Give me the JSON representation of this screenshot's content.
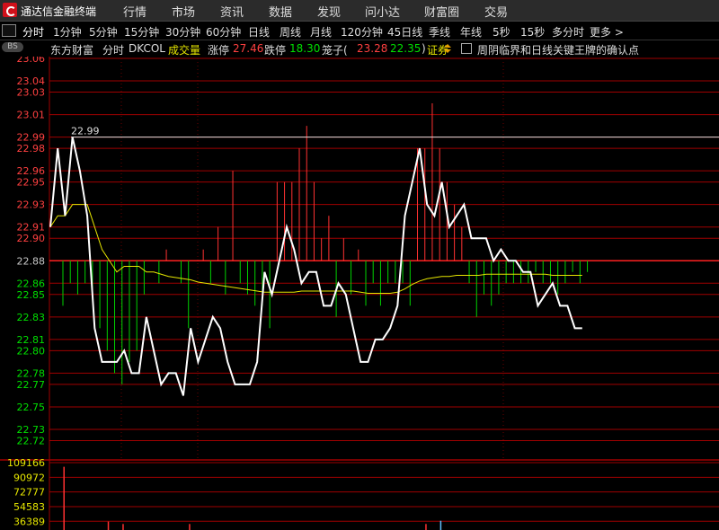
{
  "app": {
    "title": "通达信金融终端"
  },
  "menu": [
    "行情",
    "市场",
    "资讯",
    "数据",
    "发现",
    "问小达",
    "财富圈",
    "交易"
  ],
  "periods": {
    "active": "分时",
    "items": [
      "分时",
      "1分钟",
      "5分钟",
      "15分钟",
      "30分钟",
      "60分钟",
      "日线",
      "周线",
      "月线",
      "120分钟",
      "45日线",
      "季线",
      "年线",
      "5秒",
      "15秒",
      "多分时",
      "更多 >"
    ]
  },
  "info": {
    "bs_badge": "BS",
    "stock_name": "东方财富",
    "mode": "分时",
    "indicator": "DKCOL",
    "volume_label": "成交量",
    "limit_up_label": "涨停",
    "limit_up_value": "27.46",
    "limit_down_label": "跌停",
    "limit_down_value": "18.30",
    "cage_label": "笼子(",
    "cage_high": "23.28",
    "cage_low": "22.35",
    "cage_close": ")",
    "sector": "证券",
    "news": "周阴临界和日线关键王牌的确认点"
  },
  "colors": {
    "up": "#ff3232",
    "down": "#00d200",
    "grid": "#a00000",
    "price_line": "#ffffff",
    "avg_line": "#e6e600",
    "axis_up": "#ff4040",
    "axis_down": "#00e000",
    "axis_base": "#c8c8c8",
    "volume_axis": "#e6e600"
  },
  "chart_data": [
    {
      "type": "line",
      "title": "",
      "y_ticks": [
        "23.06",
        "23.04",
        "23.03",
        "23.01",
        "22.99",
        "22.98",
        "22.96",
        "22.95",
        "22.93",
        "22.91",
        "22.90",
        "22.88",
        "22.86",
        "22.85",
        "22.83",
        "22.81",
        "22.80",
        "22.78",
        "22.77",
        "22.75",
        "22.73",
        "22.72"
      ],
      "ylim": [
        22.71,
        23.06
      ],
      "base_price": 22.88,
      "reference_line": {
        "value": 22.99,
        "label": "22.99"
      },
      "series": [
        {
          "values": [
            22.91,
            22.98,
            22.92,
            22.99,
            22.96,
            22.92,
            22.82,
            22.79,
            22.79,
            22.79,
            22.8,
            22.78,
            22.78,
            22.83,
            22.8,
            22.77,
            22.78,
            22.78,
            22.76,
            22.82,
            22.79,
            22.81,
            22.83,
            22.82,
            22.79,
            22.77,
            22.77,
            22.77,
            22.79,
            22.87,
            22.85,
            22.88,
            22.91,
            22.89,
            22.86,
            22.87,
            22.87,
            22.84,
            22.84,
            22.86,
            22.85,
            22.82,
            22.79,
            22.79,
            22.81,
            22.81,
            22.82,
            22.84,
            22.92,
            22.95,
            22.98,
            22.93,
            22.92,
            22.95,
            22.91,
            22.92,
            22.93,
            22.9,
            22.9,
            22.9,
            22.88,
            22.89,
            22.88,
            22.88,
            22.87,
            22.87,
            22.84,
            22.85,
            22.86,
            22.84,
            22.84,
            22.82,
            22.82
          ]
        },
        {
          "values": [
            22.91,
            22.92,
            22.92,
            22.93,
            22.93,
            22.93,
            22.91,
            22.89,
            22.88,
            22.87,
            22.875,
            22.875,
            22.875,
            22.87,
            22.87,
            22.868,
            22.866,
            22.865,
            22.864,
            22.863,
            22.861,
            22.86,
            22.859,
            22.858,
            22.857,
            22.856,
            22.855,
            22.854,
            22.853,
            22.852,
            22.852,
            22.852,
            22.852,
            22.852,
            22.853,
            22.853,
            22.853,
            22.853,
            22.853,
            22.853,
            22.853,
            22.853,
            22.852,
            22.851,
            22.851,
            22.851,
            22.851,
            22.852,
            22.855,
            22.859,
            22.862,
            22.864,
            22.865,
            22.866,
            22.866,
            22.867,
            22.867,
            22.867,
            22.867,
            22.868,
            22.868,
            22.868,
            22.868,
            22.868,
            22.868,
            22.868,
            22.868,
            22.868,
            22.867,
            22.867,
            22.867,
            22.867,
            22.867
          ]
        }
      ],
      "dkcol_bars": [
        -0.04,
        -0.02,
        -0.03,
        -0.02,
        -0.03,
        -0.06,
        -0.08,
        -0.1,
        -0.11,
        -0.09,
        -0.08,
        -0.03,
        0,
        -0.02,
        0.01,
        0,
        -0.02,
        -0.06,
        0,
        0.01,
        -0.02,
        0.03,
        -0.03,
        0.08,
        -0.02,
        -0.03,
        -0.04,
        -0.04,
        -0.06,
        0.07,
        0.07,
        0.07,
        0.1,
        0.12,
        0.07,
        0.02,
        0.04,
        -0.05,
        0.02,
        -0.03,
        0.01,
        -0.04,
        -0.02,
        -0.04,
        -0.02,
        -0.02,
        -0.02,
        -0.04,
        0.1,
        0.1,
        0.14,
        0.1,
        0.07,
        0.05,
        0.03,
        -0.02,
        -0.05,
        -0.03,
        -0.04,
        -0.03,
        -0.02,
        -0.02,
        -0.02,
        -0.02,
        -0.01,
        -0.02,
        -0.02,
        -0.03,
        -0.02,
        -0.01,
        -0.02,
        -0.01,
        -0.01
      ]
    },
    {
      "type": "bar",
      "title": "",
      "y_ticks": [
        "109166",
        "90972",
        "72777",
        "54583",
        "36389"
      ],
      "ylim": [
        30000,
        109166
      ],
      "values": [
        0,
        104000,
        0,
        0,
        0,
        0,
        0,
        36000,
        0,
        33000,
        0,
        0,
        0,
        0,
        0,
        0,
        0,
        0,
        33000,
        0,
        0,
        0,
        0,
        0,
        0,
        0,
        0,
        0,
        0,
        0,
        0,
        0,
        0,
        0,
        0,
        0,
        0,
        0,
        0,
        0,
        0,
        0,
        0,
        0,
        0,
        0,
        0,
        0,
        0,
        0,
        33000,
        0,
        37000,
        0,
        0,
        0,
        0,
        0,
        0,
        0,
        0,
        0,
        0,
        0,
        0,
        0,
        0,
        0,
        0,
        0,
        0,
        0,
        0
      ],
      "colors": [
        "up",
        "up",
        "up",
        "down",
        "down",
        "down",
        "down",
        "up",
        "up",
        "up",
        "up",
        "up",
        "up",
        "up",
        "up",
        "up",
        "up",
        "up",
        "up",
        "up",
        "up",
        "up",
        "up",
        "up",
        "up",
        "up",
        "up",
        "up",
        "up",
        "up",
        "up",
        "up",
        "up",
        "up",
        "up",
        "up",
        "up",
        "up",
        "up",
        "up",
        "up",
        "up",
        "up",
        "up",
        "up",
        "up",
        "up",
        "up",
        "up",
        "up",
        "up",
        "up",
        "down",
        "up",
        "up",
        "up",
        "up",
        "up",
        "up",
        "up",
        "up",
        "up",
        "up",
        "up",
        "up",
        "up",
        "up",
        "up",
        "up",
        "up",
        "up",
        "up",
        "up"
      ]
    }
  ]
}
